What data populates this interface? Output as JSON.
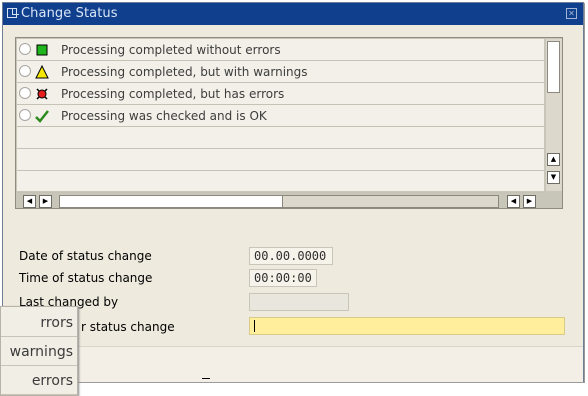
{
  "window": {
    "title": "Change Status",
    "close_icon": "close-icon"
  },
  "status_list": {
    "rows": [
      {
        "label": "Processing completed without errors",
        "icon": "green-square-icon",
        "color": "#1fb51f"
      },
      {
        "label": "Processing completed, but with warnings",
        "icon": "yellow-triangle-icon",
        "color": "#f5e600"
      },
      {
        "label": "Processing completed, but has errors",
        "icon": "red-circle-icon",
        "color": "#e41d1d"
      },
      {
        "label": "Processing was checked and is OK",
        "icon": "green-check-icon",
        "color": "#2c8a1e"
      }
    ]
  },
  "fields": {
    "date_label": "Date of status change",
    "date_value": "00.00.0000",
    "time_label": "Time of status change",
    "time_value": "00:00:00",
    "changed_by_label": "Last changed by",
    "changed_by_value": "",
    "reason_label": "r status change",
    "reason_value": ""
  },
  "dropdown": {
    "items": [
      "rrors",
      "warnings",
      "errors"
    ]
  }
}
